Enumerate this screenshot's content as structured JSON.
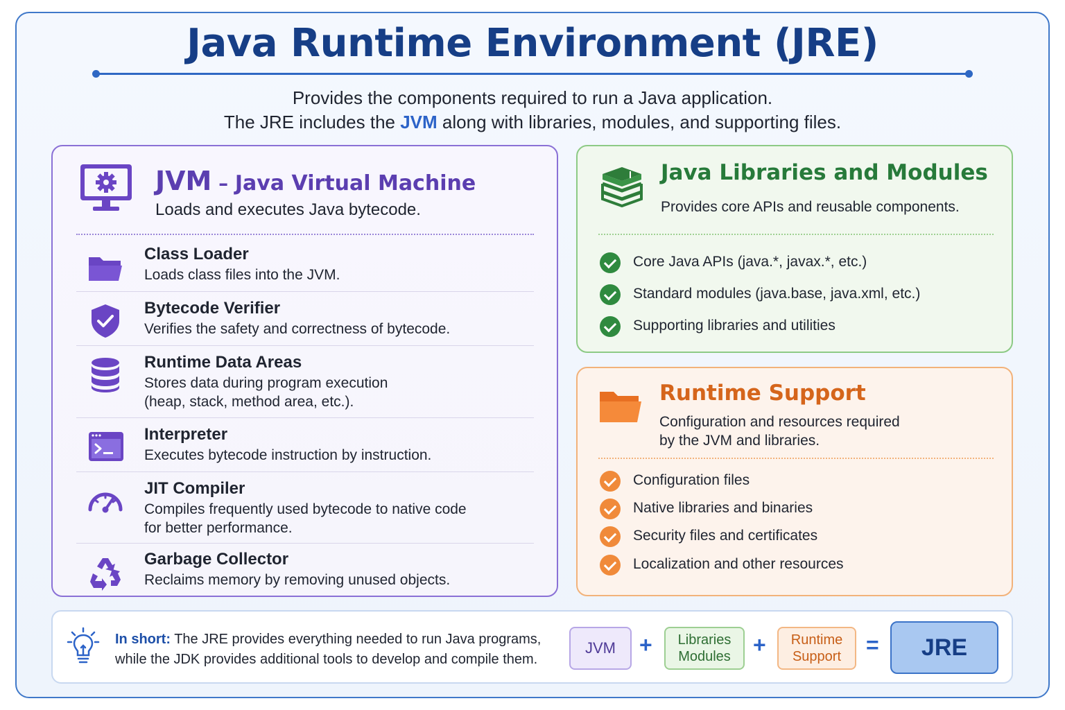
{
  "header": {
    "title": "Java Runtime Environment (JRE)",
    "subtitle_line1": "Provides the components required to run a Java application.",
    "subtitle_line2_before": "The JRE includes the ",
    "subtitle_line2_highlight": "JVM",
    "subtitle_line2_after": " along with libraries, modules, and supporting files."
  },
  "jvm": {
    "title_big": "JVM",
    "title_dash": " – ",
    "title_rest": "Java Virtual Machine",
    "description": "Loads and executes Java bytecode.",
    "components": [
      {
        "name": "Class Loader",
        "desc": "Loads class files into the JVM.",
        "icon": "folder-icon"
      },
      {
        "name": "Bytecode Verifier",
        "desc": "Verifies the safety and correctness of bytecode.",
        "icon": "shield-check-icon"
      },
      {
        "name": "Runtime Data Areas",
        "desc": "Stores data during program execution",
        "desc2": "(heap, stack, method area, etc.).",
        "icon": "database-icon"
      },
      {
        "name": "Interpreter",
        "desc": "Executes bytecode instruction by instruction.",
        "icon": "terminal-icon"
      },
      {
        "name": "JIT Compiler",
        "desc": "Compiles frequently used bytecode to native code",
        "desc2": "for better performance.",
        "icon": "speedometer-icon"
      },
      {
        "name": "Garbage Collector",
        "desc": "Reclaims memory by removing unused objects.",
        "icon": "recycle-icon"
      }
    ]
  },
  "libraries": {
    "title": "Java Libraries and Modules",
    "description": "Provides core APIs and reusable components.",
    "items": [
      "Core Java APIs (java.*, javax.*, etc.)",
      "Standard modules (java.base, java.xml, etc.)",
      "Supporting libraries and utilities"
    ]
  },
  "runtime": {
    "title": "Runtime Support",
    "description_line1": "Configuration and resources required",
    "description_line2": "by the JVM and libraries.",
    "items": [
      "Configuration files",
      "Native libraries and binaries",
      "Security files and certificates",
      "Localization and other resources"
    ]
  },
  "summary": {
    "lead": "In short:",
    "line1": " The JRE provides everything needed to run Java programs,",
    "line2": "while the JDK provides additional tools to develop and compile them.",
    "formula": {
      "jvm": "JVM",
      "plus1": "+",
      "lib_line1": "Libraries",
      "lib_line2": "Modules",
      "plus2": "+",
      "rt_line1": "Runtime",
      "rt_line2": "Support",
      "equals": "=",
      "jre": "JRE"
    }
  },
  "colors": {
    "title": "#163e86",
    "jvm_accent": "#5b3eb0",
    "lib_accent": "#277a3a",
    "rt_accent": "#d5651b",
    "check_green": "#2f8a3f",
    "check_orange": "#f08a3a"
  }
}
